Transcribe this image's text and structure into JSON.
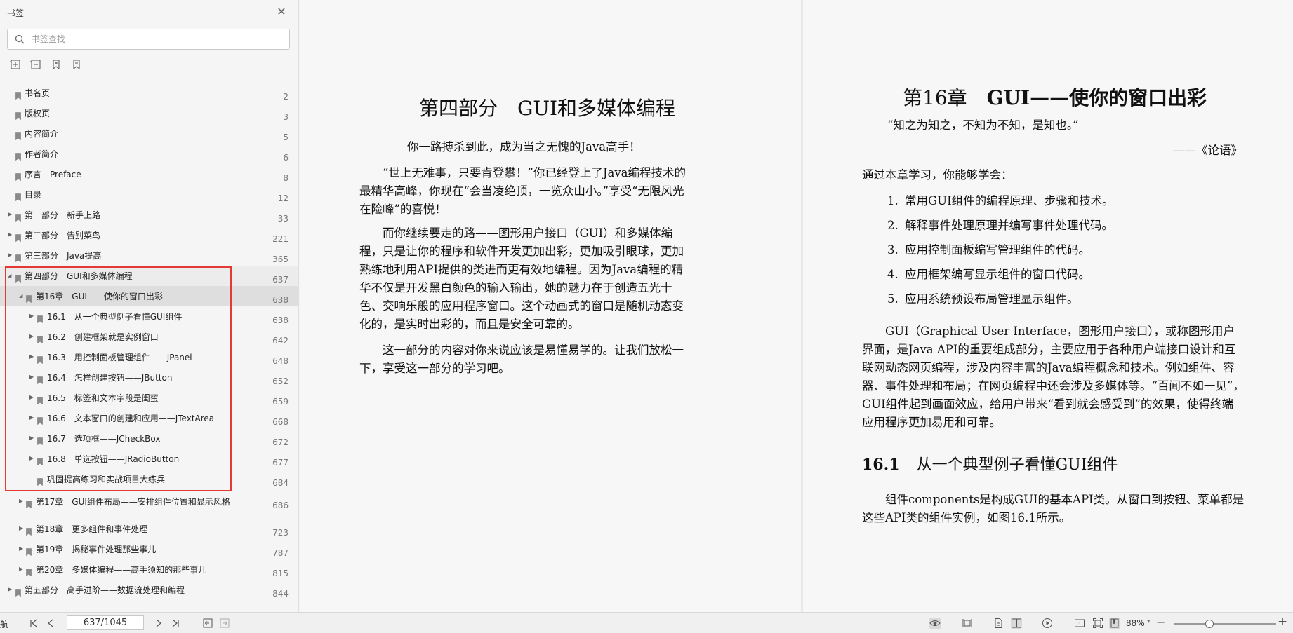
{
  "sidebar": {
    "title": "书签",
    "search_placeholder": "书签查找",
    "bookmarks": [
      {
        "label": "书名页",
        "page": "2",
        "level": 0,
        "expandable": false
      },
      {
        "label": "版权页",
        "page": "3",
        "level": 0,
        "expandable": false
      },
      {
        "label": "内容简介",
        "page": "5",
        "level": 0,
        "expandable": false
      },
      {
        "label": "作者简介",
        "page": "6",
        "level": 0,
        "expandable": false
      },
      {
        "label": "序言　Preface",
        "page": "8",
        "level": 0,
        "expandable": false
      },
      {
        "label": "目录",
        "page": "12",
        "level": 0,
        "expandable": false
      },
      {
        "label": "第一部分　新手上路",
        "page": "33",
        "level": 0,
        "expandable": true
      },
      {
        "label": "第二部分　告别菜鸟",
        "page": "221",
        "level": 0,
        "expandable": true
      },
      {
        "label": "第三部分　Java提高",
        "page": "365",
        "level": 0,
        "expandable": true
      },
      {
        "label": "第四部分　GUI和多媒体编程",
        "page": "637",
        "level": 0,
        "expandable": true,
        "expanded": true
      },
      {
        "label": "第16章　GUI——使你的窗口出彩",
        "page": "638",
        "level": 1,
        "expandable": true,
        "expanded": true,
        "selected": true
      },
      {
        "label": "16.1　从一个典型例子看懂GUI组件",
        "page": "638",
        "level": 2,
        "expandable": true
      },
      {
        "label": "16.2　创建框架就是实例窗口",
        "page": "642",
        "level": 2,
        "expandable": true
      },
      {
        "label": "16.3　用控制面板管理组件——JPanel",
        "page": "648",
        "level": 2,
        "expandable": true
      },
      {
        "label": "16.4　怎样创建按钮——JButton",
        "page": "652",
        "level": 2,
        "expandable": true
      },
      {
        "label": "16.5　标签和文本字段是闺蜜",
        "page": "659",
        "level": 2,
        "expandable": true
      },
      {
        "label": "16.6　文本窗口的创建和应用——JTextArea",
        "page": "668",
        "level": 2,
        "expandable": true
      },
      {
        "label": "16.7　选项框——JCheckBox",
        "page": "672",
        "level": 2,
        "expandable": true
      },
      {
        "label": "16.8　单选按钮——JRadioButton",
        "page": "677",
        "level": 2,
        "expandable": true
      },
      {
        "label": "巩固提高练习和实战项目大练兵",
        "page": "684",
        "level": 2,
        "expandable": false
      },
      {
        "label": "第17章　GUI组件布局——安排组件位置和显示风格",
        "page": "686",
        "level": 1,
        "expandable": true
      },
      {
        "label": "第18章　更多组件和事件处理",
        "page": "723",
        "level": 1,
        "expandable": true
      },
      {
        "label": "第19章　揭秘事件处理那些事儿",
        "page": "787",
        "level": 1,
        "expandable": true
      },
      {
        "label": "第20章　多媒体编程——高手须知的那些事儿",
        "page": "815",
        "level": 1,
        "expandable": true
      },
      {
        "label": "第五部分　高手进阶——数据流处理和编程",
        "page": "844",
        "level": 0,
        "expandable": true
      }
    ]
  },
  "page_left": {
    "heading": "第四部分　GUI和多媒体编程",
    "paragraphs": [
      "你一路搏杀到此，成为当之无愧的Java高手！",
      "“世上无难事，只要肯登攀！”你已经登上了Java编程技术的最精华高峰，你现在“会当凌绝顶，一览众山小。”享受“无限风光在险峰”的喜悦！",
      "而你继续要走的路——图形用户接口（GUI）和多媒体编程，只是让你的程序和软件开发更加出彩，更加吸引眼球，更加熟练地利用API提供的类进而更有效地编程。因为Java编程的精华不仅是开发黑白颜色的输入输出，她的魅力在于创造五光十色、交响乐般的应用程序窗口。这个动画式的窗口是随机动态变化的，是实时出彩的，而且是安全可靠的。",
      "这一部分的内容对你来说应该是易懂易学的。让我们放松一下，享受这一部分的学习吧。"
    ]
  },
  "page_right": {
    "heading_chapter": "第16章",
    "heading_title": "GUI——使你的窗口出彩",
    "quote": "“知之为知之，不知为不知，是知也。”",
    "quote_source": "——《论语》",
    "intro": "通过本章学习，你能够学会：",
    "objectives": [
      {
        "num": "1.",
        "text": "常用GUI组件的编程原理、步骤和技术。"
      },
      {
        "num": "2.",
        "text": "解释事件处理原理并编写事件处理代码。"
      },
      {
        "num": "3.",
        "text": "应用控制面板编写管理组件的代码。"
      },
      {
        "num": "4.",
        "text": "应用框架编写显示组件的窗口代码。"
      },
      {
        "num": "5.",
        "text": "应用系统预设布局管理显示组件。"
      }
    ],
    "para1": "GUI（Graphical User Interface，图形用户接口），或称图形用户界面，是Java API的重要组成部分，主要应用于各种用户端接口设计和互联网动态网页编程，涉及内容丰富的Java编程概念和技术。例如组件、容器、事件处理和布局；在网页编程中还会涉及多媒体等。“百闻不如一见”，GUI组件起到画面效应，给用户带来“看到就会感受到”的效果，使得终端应用程序更加易用和可靠。",
    "section_num": "16.1",
    "section_title": "从一个典型例子看懂GUI组件",
    "para2": "组件components是构成GUI的基本API类。从窗口到按钮、菜单都是这些API类的组件实例，如图16.1所示。"
  },
  "status": {
    "mode_label": "航",
    "page_value": "637/1045",
    "zoom": "88%",
    "zoom_fraction": 0.35
  }
}
